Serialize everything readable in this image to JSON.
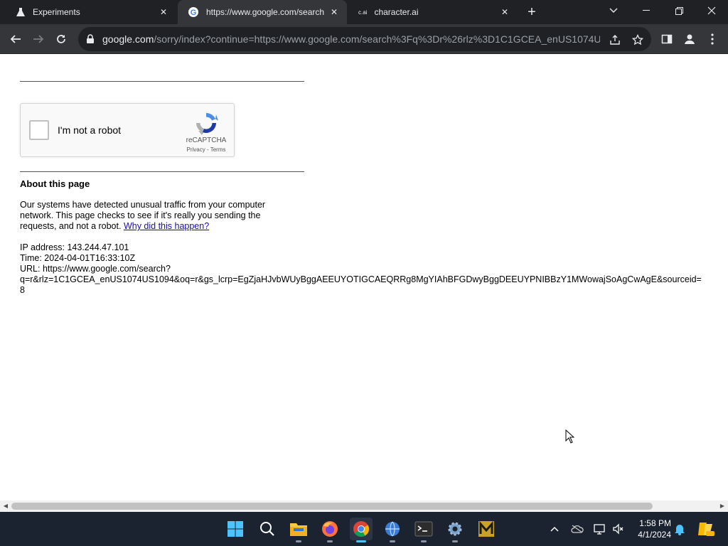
{
  "tabs": [
    {
      "title": "Experiments",
      "icon": "flask-icon",
      "active": false
    },
    {
      "title": "https://www.google.com/search",
      "icon": "google-icon",
      "active": true
    },
    {
      "title": "character.ai",
      "icon": "character-ai-icon",
      "favicon_text": "c.ai",
      "active": false
    }
  ],
  "omnibox": {
    "host": "google.com",
    "path": "/sorry/index?continue=https://www.google.com/search%3Fq%3Dr%26rlz%3D1C1GCEA_enUS1074U..."
  },
  "captcha": {
    "label": "I'm not a robot",
    "brand": "reCAPTCHA",
    "privacy": "Privacy",
    "separator": " - ",
    "terms": "Terms"
  },
  "about": {
    "title": "About this page",
    "text": "Our systems have detected unusual traffic from your computer network. This page checks to see if it's really you sending the requests, and not a robot. ",
    "link": "Why did this happen?"
  },
  "info": {
    "ip": "IP address: 143.244.47.101",
    "time": "Time: 2024-04-01T16:33:10Z",
    "url_line1": "URL: https://www.google.com/search?",
    "url_line2": "q=r&rlz=1C1GCEA_enUS1074US1094&oq=r&gs_lcrp=EgZjaHJvbWUyBggAEEUYOTIGCAEQRRg8MgYIAhBFGDwyBggDEEUYPNIBBzY1MWowajSoAgCwAgE&sourceid=",
    "url_line3": "8"
  },
  "clock": {
    "time": "1:58 PM",
    "date": "4/1/2024"
  },
  "colors": {
    "chrome_dark": "#202124",
    "toolbar": "#35363a",
    "link": "#1a0dab",
    "taskbar": "#1b2330",
    "accent": "#4cc2ff"
  }
}
